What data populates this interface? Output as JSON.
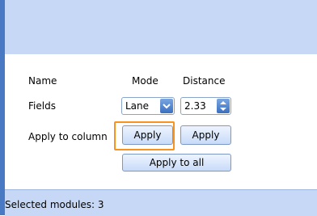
{
  "panel": {
    "headers": {
      "name": "Name",
      "mode": "Mode",
      "distance": "Distance"
    },
    "fields_label": "Fields",
    "mode_select": {
      "value": "Lane",
      "icon": "chevron-down-icon"
    },
    "distance_spinner": {
      "value": "2.33",
      "icon": "up-down-arrows-icon"
    },
    "apply_to_column_label": "Apply to column",
    "apply_mode_label": "Apply",
    "apply_distance_label": "Apply",
    "apply_all_label": "Apply to all"
  },
  "status": {
    "selected_modules": "Selected modules: 3"
  },
  "colors": {
    "accent_highlight": "#f7931e",
    "band": "#c6d8f6",
    "rail": "#4a79c3"
  }
}
